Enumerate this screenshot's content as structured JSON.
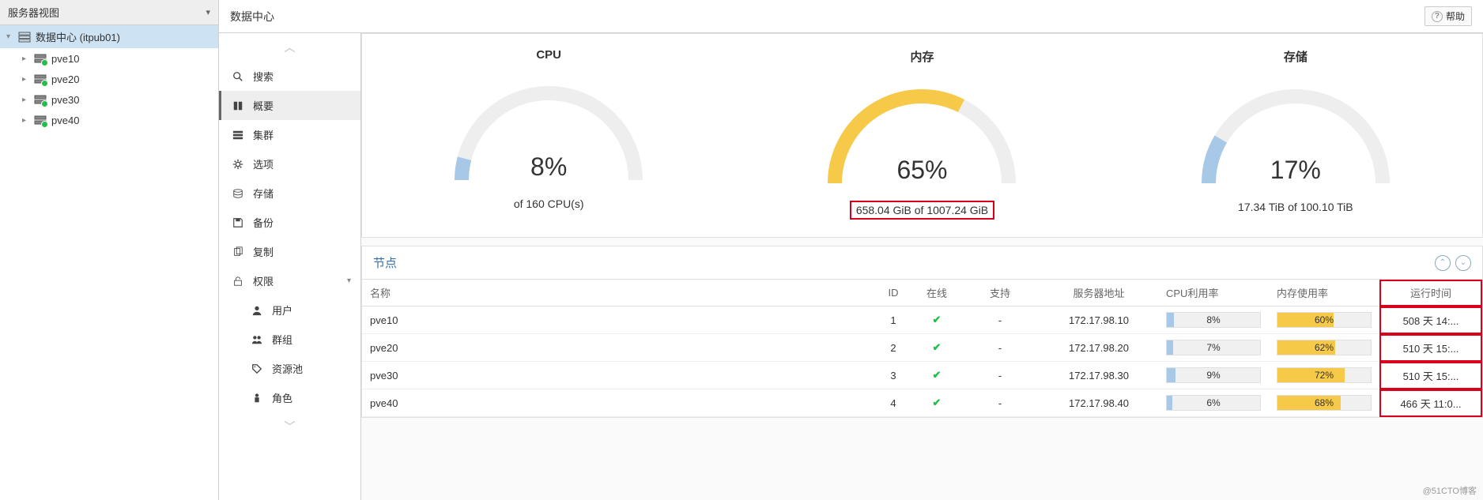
{
  "tree": {
    "view_selector": "服务器视图",
    "datacenter": "数据中心 (itpub01)",
    "nodes": [
      "pve10",
      "pve20",
      "pve30",
      "pve40"
    ]
  },
  "header": {
    "title": "数据中心",
    "help": "帮助"
  },
  "submenu": {
    "items": [
      {
        "icon": "search",
        "label": "搜索"
      },
      {
        "icon": "book",
        "label": "概要",
        "active": true
      },
      {
        "icon": "cluster",
        "label": "集群"
      },
      {
        "icon": "gear",
        "label": "选项"
      },
      {
        "icon": "storage",
        "label": "存储"
      },
      {
        "icon": "save",
        "label": "备份"
      },
      {
        "icon": "copy",
        "label": "复制"
      },
      {
        "icon": "lock",
        "label": "权限",
        "expandable": true
      },
      {
        "icon": "user",
        "label": "用户",
        "sub": true
      },
      {
        "icon": "group",
        "label": "群组",
        "sub": true
      },
      {
        "icon": "tag",
        "label": "资源池",
        "sub": true
      },
      {
        "icon": "role",
        "label": "角色",
        "sub": true
      }
    ]
  },
  "chart_data": [
    {
      "type": "gauge",
      "title": "CPU",
      "value_pct": 8,
      "subtitle": "of 160 CPU(s)",
      "color": "#a8c8e8"
    },
    {
      "type": "gauge",
      "title": "内存",
      "value_pct": 65,
      "subtitle": "658.04 GiB of 1007.24 GiB",
      "color": "#f7c948",
      "highlight": true
    },
    {
      "type": "gauge",
      "title": "存储",
      "value_pct": 17,
      "subtitle": "17.34 TiB of 100.10 TiB",
      "color": "#a8c8e8"
    }
  ],
  "nodes_panel": {
    "title": "节点",
    "columns": {
      "name": "名称",
      "id": "ID",
      "online": "在线",
      "support": "支持",
      "addr": "服务器地址",
      "cpu": "CPU利用率",
      "mem": "内存使用率",
      "uptime": "运行时间"
    },
    "rows": [
      {
        "name": "pve10",
        "id": 1,
        "online": true,
        "support": "-",
        "addr": "172.17.98.10",
        "cpu_pct": 8,
        "mem_pct": 60,
        "uptime": "508 天 14:..."
      },
      {
        "name": "pve20",
        "id": 2,
        "online": true,
        "support": "-",
        "addr": "172.17.98.20",
        "cpu_pct": 7,
        "mem_pct": 62,
        "uptime": "510 天 15:..."
      },
      {
        "name": "pve30",
        "id": 3,
        "online": true,
        "support": "-",
        "addr": "172.17.98.30",
        "cpu_pct": 9,
        "mem_pct": 72,
        "uptime": "510 天 15:..."
      },
      {
        "name": "pve40",
        "id": 4,
        "online": true,
        "support": "-",
        "addr": "172.17.98.40",
        "cpu_pct": 6,
        "mem_pct": 68,
        "uptime": "466 天 11:0..."
      }
    ]
  },
  "watermark": "@51CTO博客"
}
